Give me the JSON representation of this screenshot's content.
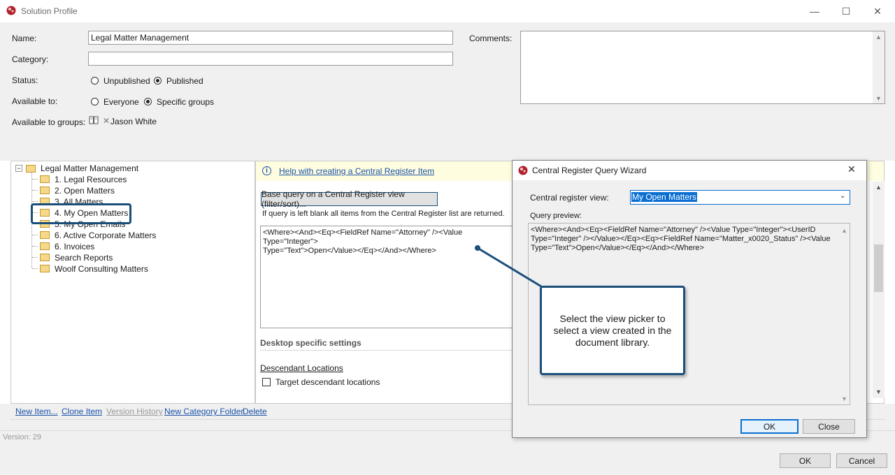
{
  "window": {
    "title": "Solution Profile",
    "minimize": "—",
    "maximize": "☐",
    "close": "✕"
  },
  "form": {
    "name_label": "Name:",
    "name_value": "Legal Matter Management",
    "category_label": "Category:",
    "category_value": "",
    "status_label": "Status:",
    "status_options": [
      "Unpublished",
      "Published"
    ],
    "status_selected": "Published",
    "available_label": "Available to:",
    "available_options": [
      "Everyone",
      "Specific groups"
    ],
    "available_selected": "Specific groups",
    "groups_label": "Available to groups:",
    "group_item": "Jason White",
    "comments_label": "Comments:"
  },
  "tree": {
    "root": "Legal Matter Management",
    "items": [
      "1. Legal Resources",
      "2. Open Matters",
      "3. All Matters",
      "4. My Open Matters",
      "5. My Open Emails",
      "6. Active Corporate Matters",
      "6. Invoices",
      "Search Reports",
      "Woolf Consulting Matters"
    ],
    "selected": "4. My Open Matters"
  },
  "panel": {
    "help_link": "Help with creating a Central Register Item",
    "base_query_button": "Base query on a Central Register view (filter/sort)...",
    "blank_note": "If query is left blank all items from the Central Register list are returned.",
    "query_text": "<Where><And><Eq><FieldRef Name=\"Attorney\" /><Value Type=\"Integer\">\nType=\"Text\">Open</Value></Eq></And></Where>",
    "desktop_heading": "Desktop specific settings",
    "descendant_heading": "Descendant Locations",
    "target_descendant": "Target descendant locations"
  },
  "bottom_links": [
    "New Item...",
    "Clone Item",
    "Version History",
    "New Category Folder",
    "Delete"
  ],
  "version": "Version: 29",
  "footer": {
    "ok": "OK",
    "cancel": "Cancel"
  },
  "dialog": {
    "title": "Central Register Query Wizard",
    "close": "✕",
    "view_label": "Central register view:",
    "view_value": "My Open Matters",
    "preview_label": "Query preview:",
    "preview_text": "<Where><And><Eq><FieldRef Name=\"Attorney\" /><Value Type=\"Integer\"><UserID\nType=\"Integer\" /></Value></Eq><Eq><FieldRef Name=\"Matter_x0020_Status\" /><Value\nType=\"Text\">Open</Value></Eq></And></Where>",
    "ok": "OK",
    "close_button": "Close"
  },
  "callout": {
    "text": "Select the view picker to select a view created in the document library."
  },
  "colors": {
    "accent": "#0a6fd1",
    "callout_border": "#1b4f7a",
    "link": "#1a52a8",
    "help_bg": "#fffde0"
  }
}
